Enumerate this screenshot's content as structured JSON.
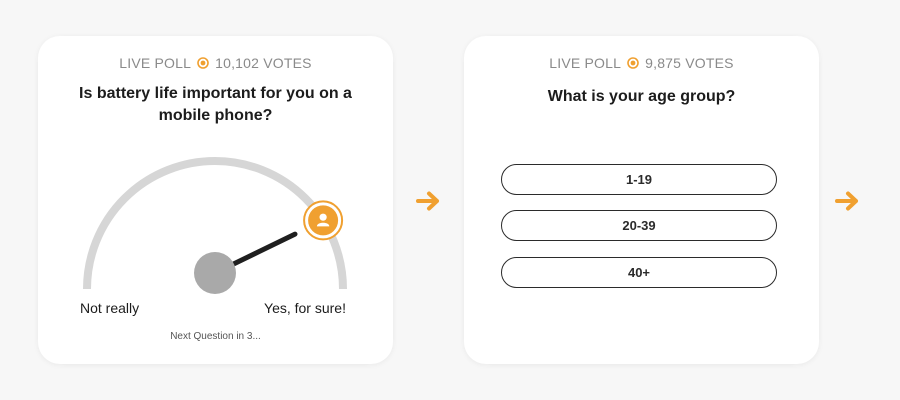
{
  "polls": [
    {
      "live_label": "LIVE POLL",
      "votes": "10,102 VOTES",
      "question": "Is battery life important for you on a mobile phone?",
      "scale_min_label": "Not really",
      "scale_max_label": "Yes, for sure!",
      "next_question": "Next Question in 3...",
      "gauge_value_fraction": 0.82
    },
    {
      "live_label": "LIVE POLL",
      "votes": "9,875 VOTES",
      "question": "What is your age group?",
      "options": [
        "1-19",
        "20-39",
        "40+"
      ]
    }
  ],
  "icons": {
    "live": "live-dot-icon",
    "avatar": "user-avatar-icon",
    "arrow": "arrow-right-icon"
  },
  "colors": {
    "accent": "#f0a030",
    "gauge_track": "#d6d6d6",
    "knob": "#a9a9a9",
    "needle": "#1f1f1f",
    "text_muted": "#8a8a8a"
  }
}
